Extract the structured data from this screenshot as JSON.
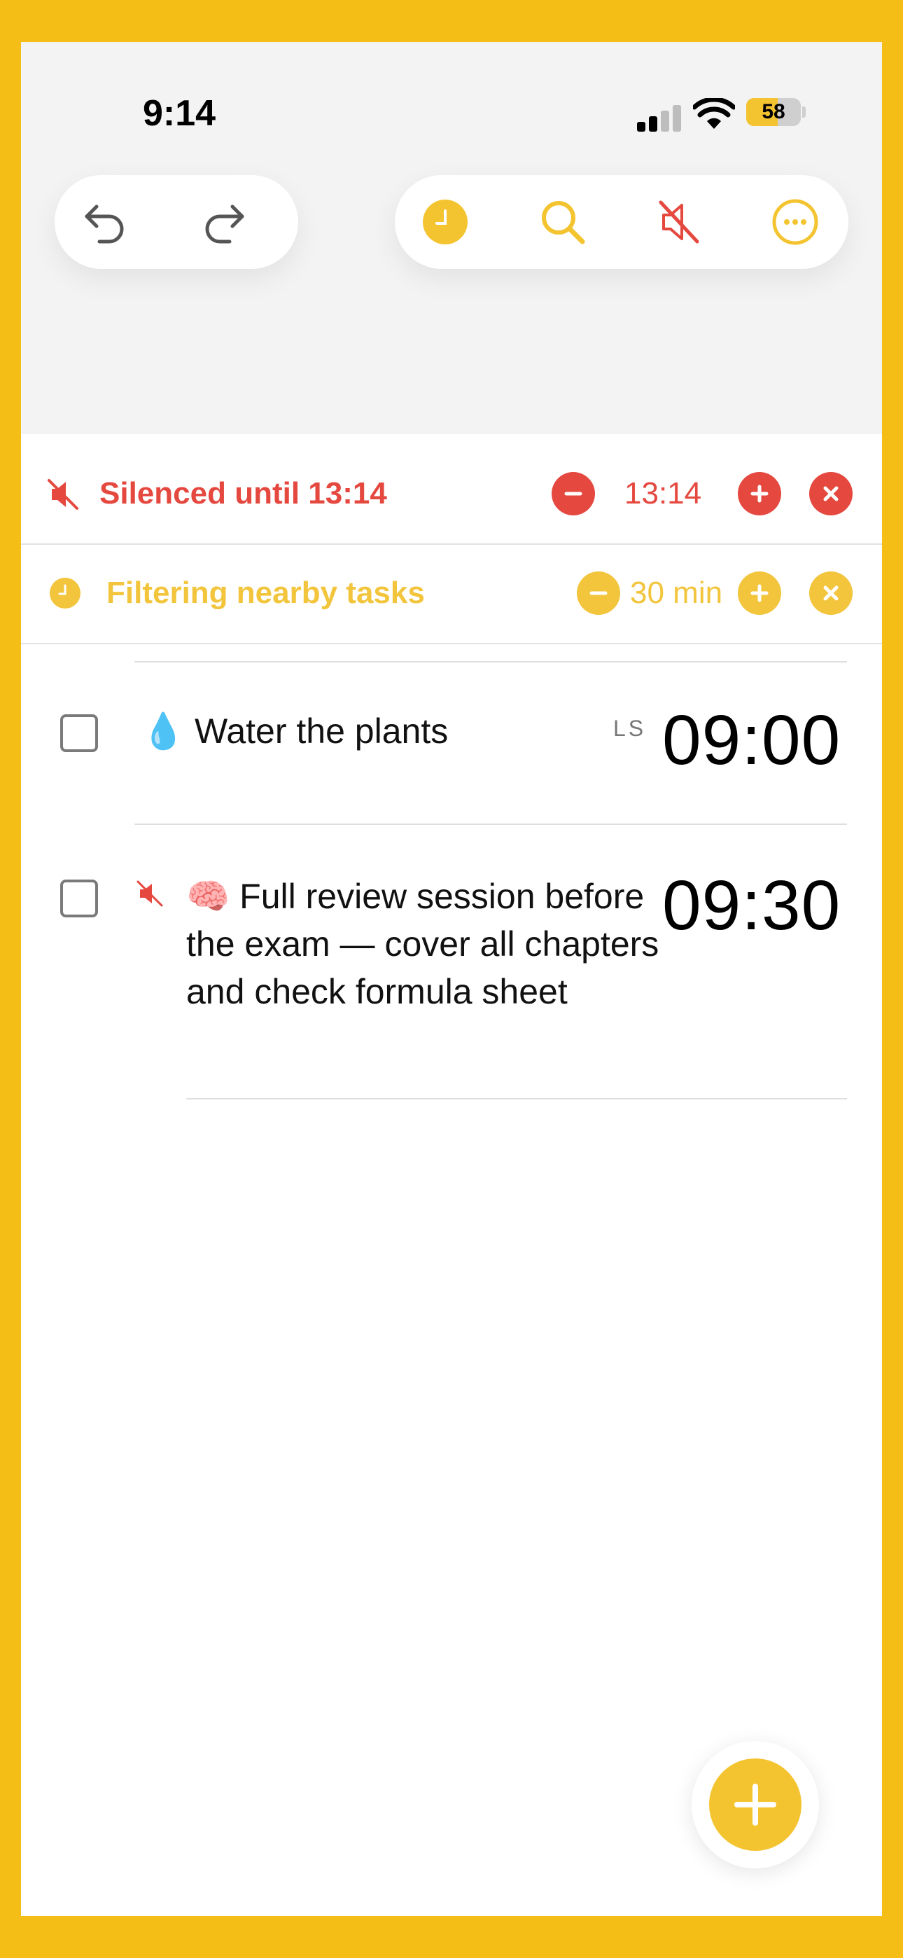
{
  "status_bar": {
    "time": "9:14",
    "battery_level": "58",
    "battery_fraction": 0.58
  },
  "toolbar": {
    "undo_icon": "undo-arrow",
    "redo_icon": "redo-arrow",
    "nearby_icon": "clock-filled",
    "search_icon": "magnifier",
    "silence_icon": "speaker-muted",
    "more_icon": "ellipsis-circle"
  },
  "silenced_banner": {
    "label": "Silenced until 13:14",
    "value": "13:14",
    "color": "#E5483F"
  },
  "filter_banner": {
    "label": "Filtering nearby tasks",
    "value": "30 min",
    "color": "#F2C53D"
  },
  "tasks": [
    {
      "emoji": "💧",
      "title": "Water the plants",
      "tag": "LS",
      "time": "09:00",
      "silenced": false
    },
    {
      "emoji": "🧠",
      "title": "Full review session before the exam — cover all chapters and check formula sheet",
      "tag": "",
      "time": "09:30",
      "silenced": true
    }
  ],
  "colors": {
    "accent": "#F4C430",
    "danger": "#E5483F",
    "frame": "#F4BE16"
  }
}
